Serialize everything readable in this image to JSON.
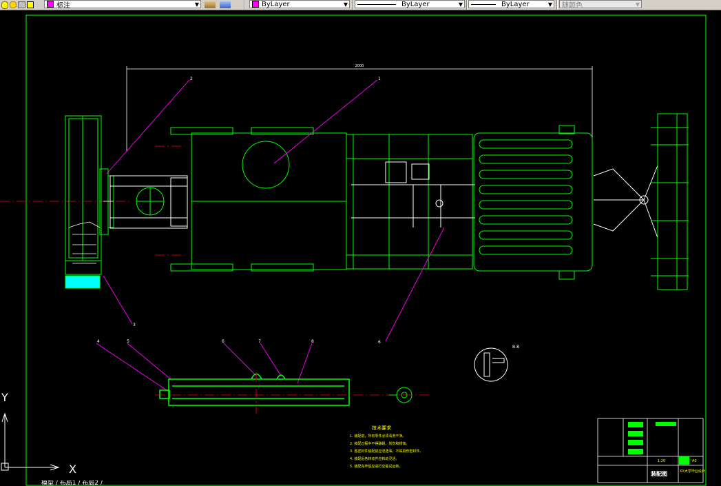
{
  "toolbar": {
    "layer_name": "标注",
    "color_value": "ByLayer",
    "linetype_value": "ByLayer",
    "lineweight_value": "ByLayer",
    "plotstyle_value": "随颜色",
    "colors": {
      "layer_swatch": "#ff00ff",
      "color_swatch": "#ff00ff"
    }
  },
  "drawing": {
    "dimension_text": "2000",
    "callouts_top": [
      "2",
      "1"
    ],
    "callout_left": "3",
    "callout_right": "6",
    "callouts_bottom": [
      "4",
      "5",
      "6",
      "7",
      "8"
    ],
    "symbol_label": "B-B",
    "notes_title": "技术要求",
    "notes": [
      "1. 装配前，所有零件必须清洗干净。",
      "2. 装配过程中不得磕碰、划伤和锈蚀。",
      "3. 各密封件装配前应浸透油，不得损伤密封件。",
      "4. 装配后各转动件应转动灵活。",
      "5. 装配完毕后应进行空载试运转。"
    ],
    "title_block": {
      "drawing_title": "装配图",
      "school": "XX大学毕业设计",
      "sheet_label": "1:20",
      "code": "A0"
    }
  },
  "ucs": {
    "y_label": "Y",
    "x_label": "X"
  },
  "bottom_tabs": "模型 / 布局1 / 布局2 /",
  "colors": {
    "background": "#000000",
    "border_green": "#00ff00",
    "white": "#ffffff",
    "magenta": "#ff00ff",
    "red": "#ff0000"
  }
}
